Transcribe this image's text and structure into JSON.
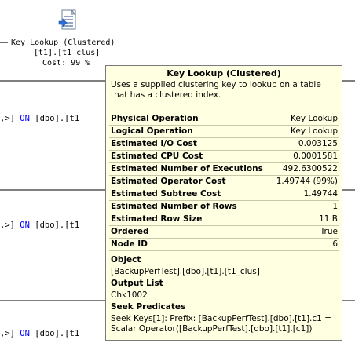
{
  "plan_node": {
    "icon": "key-lookup-icon",
    "title": "Key Lookup (Clustered)",
    "object": "[t1].[t1_clus]",
    "cost": "Cost: 99 %"
  },
  "query_lines": [
    {
      "prefix": ",>]",
      "keyword": "ON",
      "rest": "[dbo].[t1"
    },
    {
      "prefix": ",>]",
      "keyword": "ON",
      "rest": "[dbo].[t1"
    },
    {
      "prefix": ",>]",
      "keyword": "ON",
      "rest": "[dbo].[t1"
    }
  ],
  "tooltip": {
    "title": "Key Lookup (Clustered)",
    "description": "Uses a supplied clustering key to lookup on a table that has a clustered index.",
    "properties": [
      {
        "key": "Physical Operation",
        "value": "Key Lookup"
      },
      {
        "key": "Logical Operation",
        "value": "Key Lookup"
      },
      {
        "key": "Estimated I/O Cost",
        "value": "0.003125"
      },
      {
        "key": "Estimated CPU Cost",
        "value": "0.0001581"
      },
      {
        "key": "Estimated Number of Executions",
        "value": "492.6300522"
      },
      {
        "key": "Estimated Operator Cost",
        "value": "1.49744 (99%)"
      },
      {
        "key": "Estimated Subtree Cost",
        "value": "1.49744"
      },
      {
        "key": "Estimated Number of Rows",
        "value": "1"
      },
      {
        "key": "Estimated Row Size",
        "value": "11 B"
      },
      {
        "key": "Ordered",
        "value": "True"
      },
      {
        "key": "Node ID",
        "value": "6"
      }
    ],
    "object_label": "Object",
    "object_value": "[BackupPerfTest].[dbo].[t1].[t1_clus]",
    "output_label": "Output List",
    "output_value": "Chk1002",
    "seek_label": "Seek Predicates",
    "seek_value": "Seek Keys[1]: Prefix: [BackupPerfTest].[dbo].[t1].c1 = Scalar Operator([BackupPerfTest].[dbo].[t1].[c1])"
  },
  "colors": {
    "tooltip_bg": "#ffffe1",
    "keyword": "#0000ff"
  }
}
